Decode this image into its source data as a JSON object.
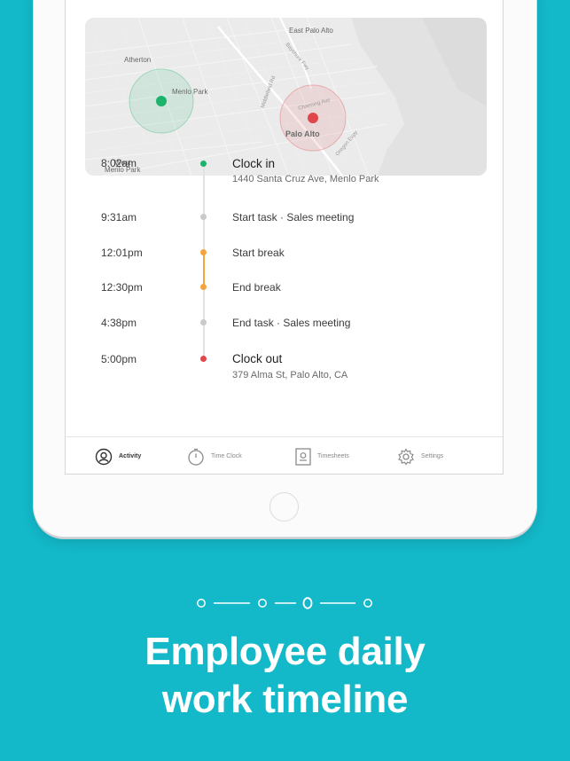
{
  "colors": {
    "background": "#13b8c9",
    "clock_in_green": "#1cb36d",
    "clock_out_red": "#e0474c",
    "break_orange": "#f4a43e",
    "task_gray": "#c9c9c9"
  },
  "map": {
    "labels": {
      "atherton": "Atherton",
      "menlo_park": "Menlo Park",
      "west_menlo_park": "West\nMenlo Park",
      "east_palo_alto": "East Palo Alto",
      "palo_alto": "Palo Alto",
      "bayshore_fwy": "Bayshore Fwy",
      "middlefield_rd": "Middlefield Rd",
      "oregon_expy": "Oregon Expy",
      "channing_ave": "Channing Ave"
    }
  },
  "timeline": {
    "entries": [
      {
        "time": "8:02am",
        "event": "Clock in",
        "address": "1440 Santa Cruz Ave, Menlo Park",
        "kind": "clock-in"
      },
      {
        "time": "9:31am",
        "event": "Start task · Sales meeting",
        "kind": "task"
      },
      {
        "time": "12:01pm",
        "event": "Start break",
        "kind": "break"
      },
      {
        "time": "12:30pm",
        "event": "End break",
        "kind": "break"
      },
      {
        "time": "4:38pm",
        "event": "End task · Sales meeting",
        "kind": "task"
      },
      {
        "time": "5:00pm",
        "event": "Clock out",
        "address": "379 Alma St, Palo Alto, CA",
        "kind": "clock-out"
      }
    ]
  },
  "tabbar": {
    "tabs": [
      {
        "label": "Activity",
        "icon": "activity-icon",
        "active": true
      },
      {
        "label": "Time Clock",
        "icon": "stopwatch-icon",
        "active": false
      },
      {
        "label": "Timesheets",
        "icon": "timesheet-icon",
        "active": false
      },
      {
        "label": "Settings",
        "icon": "gear-icon",
        "active": false
      }
    ]
  },
  "pager": {
    "total": 4,
    "current": 3
  },
  "headline": {
    "line1": "Employee daily",
    "line2": "work timeline"
  }
}
